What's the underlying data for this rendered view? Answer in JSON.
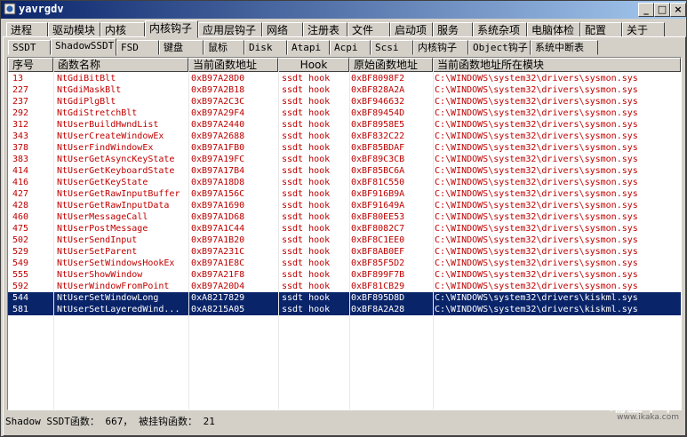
{
  "window": {
    "title": "yavrgdv"
  },
  "title_buttons": {
    "minimize": "_",
    "maximize": "□",
    "close": "×"
  },
  "main_tabs": [
    "进程",
    "驱动模块",
    "内核",
    "内核钩子",
    "应用层钩子",
    "网络",
    "注册表",
    "文件",
    "启动项",
    "服务",
    "系统杂项",
    "电脑体检",
    "配置",
    "关于"
  ],
  "main_tab_active": "内核钩子",
  "sub_tabs": [
    "SSDT",
    "ShadowSSDT",
    "FSD",
    "键盘",
    "鼠标",
    "Disk",
    "Atapi",
    "Acpi",
    "Scsi",
    "内核钩子",
    "Object钩子",
    "系统中断表"
  ],
  "sub_tab_active": "ShadowSSDT",
  "columns": [
    "序号",
    "函数名称",
    "当前函数地址",
    "Hook",
    "原始函数地址",
    "当前函数地址所在模块"
  ],
  "rows": [
    [
      "13",
      "NtGdiBitBlt",
      "0xB97A28D0",
      "ssdt hook",
      "0xBF8098F2",
      "C:\\WINDOWS\\system32\\drivers\\sysmon.sys"
    ],
    [
      "227",
      "NtGdiMaskBlt",
      "0xB97A2B18",
      "ssdt hook",
      "0xBF828A2A",
      "C:\\WINDOWS\\system32\\drivers\\sysmon.sys"
    ],
    [
      "237",
      "NtGdiPlgBlt",
      "0xB97A2C3C",
      "ssdt hook",
      "0xBF946632",
      "C:\\WINDOWS\\system32\\drivers\\sysmon.sys"
    ],
    [
      "292",
      "NtGdiStretchBlt",
      "0xB97A29F4",
      "ssdt hook",
      "0xBF89454D",
      "C:\\WINDOWS\\system32\\drivers\\sysmon.sys"
    ],
    [
      "312",
      "NtUserBuildHwndList",
      "0xB97A2440",
      "ssdt hook",
      "0xBF8958E5",
      "C:\\WINDOWS\\system32\\drivers\\sysmon.sys"
    ],
    [
      "343",
      "NtUserCreateWindowEx",
      "0xB97A2688",
      "ssdt hook",
      "0xBF832C22",
      "C:\\WINDOWS\\system32\\drivers\\sysmon.sys"
    ],
    [
      "378",
      "NtUserFindWindowEx",
      "0xB97A1FB0",
      "ssdt hook",
      "0xBF85BDAF",
      "C:\\WINDOWS\\system32\\drivers\\sysmon.sys"
    ],
    [
      "383",
      "NtUserGetAsyncKeyState",
      "0xB97A19FC",
      "ssdt hook",
      "0xBF89C3CB",
      "C:\\WINDOWS\\system32\\drivers\\sysmon.sys"
    ],
    [
      "414",
      "NtUserGetKeyboardState",
      "0xB97A17B4",
      "ssdt hook",
      "0xBF85BC6A",
      "C:\\WINDOWS\\system32\\drivers\\sysmon.sys"
    ],
    [
      "416",
      "NtUserGetKeyState",
      "0xB97A18D8",
      "ssdt hook",
      "0xBF81C550",
      "C:\\WINDOWS\\system32\\drivers\\sysmon.sys"
    ],
    [
      "427",
      "NtUserGetRawInputBuffer",
      "0xB97A156C",
      "ssdt hook",
      "0xBF916B9A",
      "C:\\WINDOWS\\system32\\drivers\\sysmon.sys"
    ],
    [
      "428",
      "NtUserGetRawInputData",
      "0xB97A1690",
      "ssdt hook",
      "0xBF91649A",
      "C:\\WINDOWS\\system32\\drivers\\sysmon.sys"
    ],
    [
      "460",
      "NtUserMessageCall",
      "0xB97A1D68",
      "ssdt hook",
      "0xBF80EE53",
      "C:\\WINDOWS\\system32\\drivers\\sysmon.sys"
    ],
    [
      "475",
      "NtUserPostMessage",
      "0xB97A1C44",
      "ssdt hook",
      "0xBF8082C7",
      "C:\\WINDOWS\\system32\\drivers\\sysmon.sys"
    ],
    [
      "502",
      "NtUserSendInput",
      "0xB97A1B20",
      "ssdt hook",
      "0xBF8C1EE0",
      "C:\\WINDOWS\\system32\\drivers\\sysmon.sys"
    ],
    [
      "529",
      "NtUserSetParent",
      "0xB97A231C",
      "ssdt hook",
      "0xBF8AB0EF",
      "C:\\WINDOWS\\system32\\drivers\\sysmon.sys"
    ],
    [
      "549",
      "NtUserSetWindowsHookEx",
      "0xB97A1E8C",
      "ssdt hook",
      "0xBF85F5D2",
      "C:\\WINDOWS\\system32\\drivers\\sysmon.sys"
    ],
    [
      "555",
      "NtUserShowWindow",
      "0xB97A21F8",
      "ssdt hook",
      "0xBF899F7B",
      "C:\\WINDOWS\\system32\\drivers\\sysmon.sys"
    ],
    [
      "592",
      "NtUserWindowFromPoint",
      "0xB97A20D4",
      "ssdt hook",
      "0xBF81CB29",
      "C:\\WINDOWS\\system32\\drivers\\sysmon.sys"
    ],
    [
      "544",
      "NtUserSetWindowLong",
      "0xA8217829",
      "ssdt hook",
      "0xBF895D8D",
      "C:\\WINDOWS\\system32\\drivers\\kiskml.sys"
    ],
    [
      "581",
      "NtUserSetLayeredWind...",
      "0xA8215A05",
      "ssdt hook",
      "0xBF8A2A28",
      "C:\\WINDOWS\\system32\\drivers\\kiskml.sys"
    ]
  ],
  "selected_rows": [
    19,
    20
  ],
  "status": {
    "text": "Shadow SSDT函数： 667， 被挂钩函数： 21"
  },
  "watermark": {
    "brand": "瑞星卡卡",
    "url": "www.ikaka.com"
  }
}
